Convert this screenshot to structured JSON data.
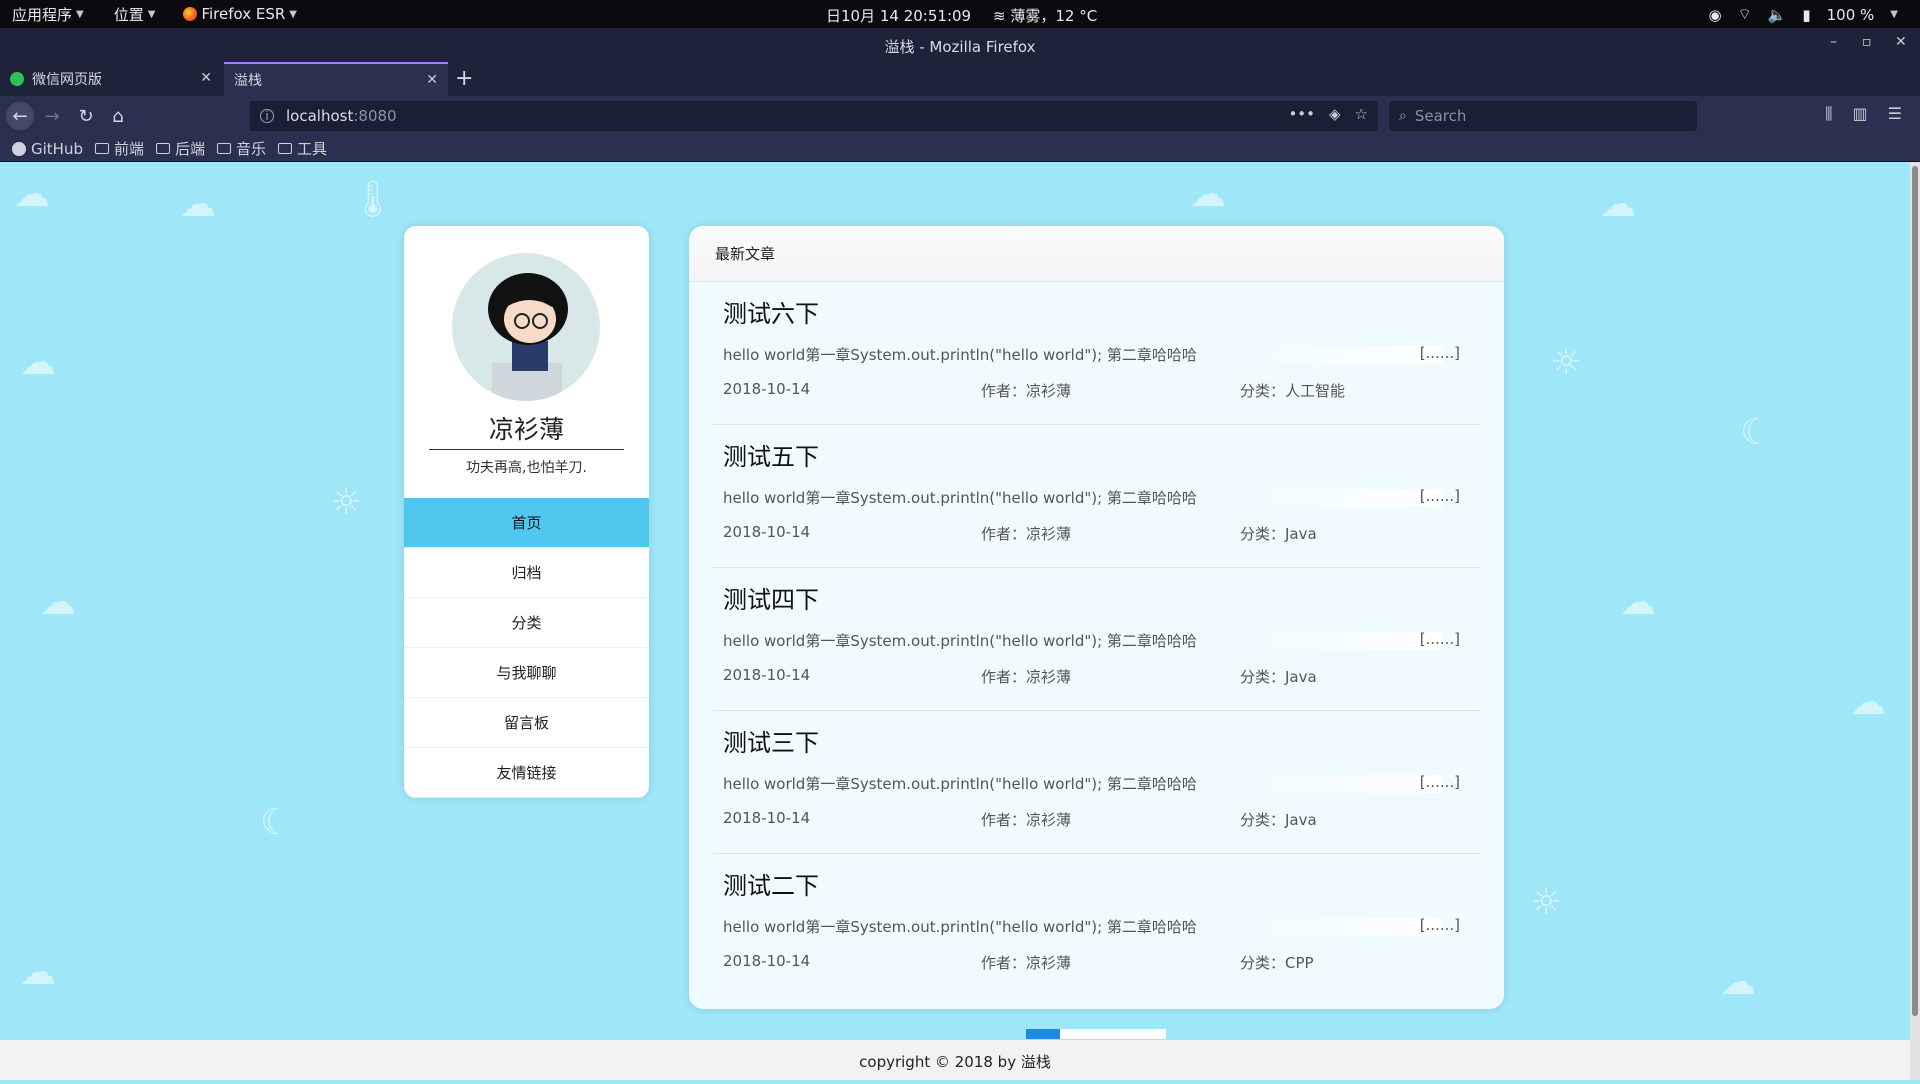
{
  "system_bar": {
    "apps_label": "应用程序",
    "places_label": "位置",
    "browser_label": "Firefox ESR",
    "clock": "日10月 14  20:51:09",
    "weather": "薄雾，12 °C",
    "battery": "100 %"
  },
  "window": {
    "title": "溢栈 - Mozilla Firefox"
  },
  "tabs": [
    {
      "label": "微信网页版"
    },
    {
      "label": "溢栈"
    }
  ],
  "nav": {
    "url_host": "localhost",
    "url_port": ":8080",
    "search_placeholder": "Search"
  },
  "bookmarks": [
    {
      "label": "GitHub"
    },
    {
      "label": "前端"
    },
    {
      "label": "后端"
    },
    {
      "label": "音乐"
    },
    {
      "label": "工具"
    }
  ],
  "profile": {
    "name": "凉衫薄",
    "motto": "功夫再高,也怕羊刀.",
    "menu": [
      {
        "label": "首页",
        "active": true
      },
      {
        "label": "归档"
      },
      {
        "label": "分类"
      },
      {
        "label": "与我聊聊"
      },
      {
        "label": "留言板"
      },
      {
        "label": "友情链接"
      }
    ]
  },
  "articles": {
    "header": "最新文章",
    "items": [
      {
        "title": "测试六下",
        "summary": "hello world第一章System.out.println(\"hello world\"); 第二章哈哈哈",
        "more": "[......]",
        "date": "2018-10-14",
        "author": "作者：凉衫薄",
        "category": "分类：人工智能"
      },
      {
        "title": "测试五下",
        "summary": "hello world第一章System.out.println(\"hello world\"); 第二章哈哈哈",
        "more": "[......]",
        "date": "2018-10-14",
        "author": "作者：凉衫薄",
        "category": "分类：Java"
      },
      {
        "title": "测试四下",
        "summary": "hello world第一章System.out.println(\"hello world\"); 第二章哈哈哈",
        "more": "[......]",
        "date": "2018-10-14",
        "author": "作者：凉衫薄",
        "category": "分类：Java"
      },
      {
        "title": "测试三下",
        "summary": "hello world第一章System.out.println(\"hello world\"); 第二章哈哈哈",
        "more": "[......]",
        "date": "2018-10-14",
        "author": "作者：凉衫薄",
        "category": "分类：Java"
      },
      {
        "title": "测试二下",
        "summary": "hello world第一章System.out.println(\"hello world\"); 第二章哈哈哈",
        "more": "[......]",
        "date": "2018-10-14",
        "author": "作者：凉衫薄",
        "category": "分类：CPP"
      }
    ]
  },
  "footer": {
    "text": "copyright © 2018 by 溢栈"
  },
  "colors": {
    "page_bg": "#9fe6f9",
    "menu_active": "#4fc7ef",
    "pager_active": "#1e88e5"
  }
}
